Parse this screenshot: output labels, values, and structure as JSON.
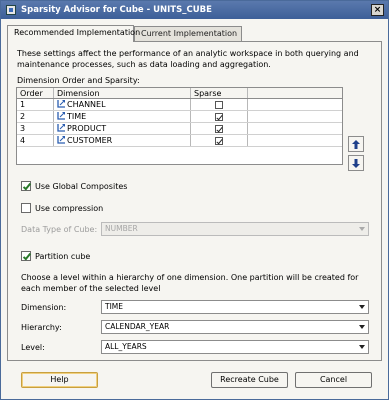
{
  "window": {
    "title": "Sparsity Advisor for Cube - UNITS_CUBE",
    "close_glyph": "×"
  },
  "tabs": [
    {
      "label": "Recommended Implementation",
      "active": true
    },
    {
      "label": "Current Implementation",
      "active": false
    }
  ],
  "intro": "These settings affect the performance of an analytic workspace in both querying and maintenance processes, such as data loading and aggregation.",
  "dimension_section_label": "Dimension Order and Sparsity:",
  "grid": {
    "headers": {
      "order": "Order",
      "dimension": "Dimension",
      "sparse": "Sparse"
    },
    "rows": [
      {
        "order": "1",
        "dimension": "CHANNEL",
        "sparse": false
      },
      {
        "order": "2",
        "dimension": "TIME",
        "sparse": true
      },
      {
        "order": "3",
        "dimension": "PRODUCT",
        "sparse": true
      },
      {
        "order": "4",
        "dimension": "CUSTOMER",
        "sparse": true
      }
    ]
  },
  "move_buttons": {
    "up": "↑",
    "down": "↓"
  },
  "options": {
    "use_global_composites": {
      "label": "Use Global Composites",
      "checked": true
    },
    "use_compression": {
      "label": "Use compression",
      "checked": false
    },
    "data_type_label": "Data Type of Cube:",
    "data_type_value": "NUMBER",
    "partition_cube": {
      "label": "Partition cube",
      "checked": true
    }
  },
  "partition": {
    "description": "Choose a level within a hierarchy of one dimension. One partition will be created for each member of the selected level",
    "dimension_label": "Dimension:",
    "dimension_value": "TIME",
    "hierarchy_label": "Hierarchy:",
    "hierarchy_value": "CALENDAR_YEAR",
    "level_label": "Level:",
    "level_value": "ALL_YEARS"
  },
  "buttons": {
    "help": "Help",
    "recreate": "Recreate Cube",
    "cancel": "Cancel"
  },
  "colors": {
    "titlebar": "#3d5f98",
    "checkmark": "#2a7a2a",
    "dimension_icon": "#2a5db0"
  }
}
